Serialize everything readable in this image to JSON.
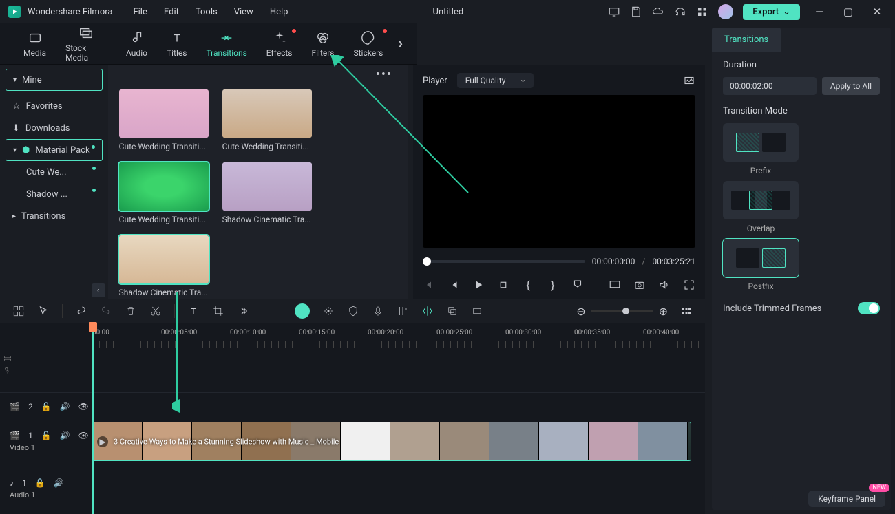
{
  "app": {
    "name": "Wondershare Filmora",
    "doc_title": "Untitled"
  },
  "menus": [
    "File",
    "Edit",
    "Tools",
    "View",
    "Help"
  ],
  "export_label": "Export",
  "toolbar": [
    {
      "id": "media",
      "label": "Media"
    },
    {
      "id": "stock-media",
      "label": "Stock Media"
    },
    {
      "id": "audio",
      "label": "Audio"
    },
    {
      "id": "titles",
      "label": "Titles"
    },
    {
      "id": "transitions",
      "label": "Transitions",
      "active": true
    },
    {
      "id": "effects",
      "label": "Effects",
      "dot": true
    },
    {
      "id": "filters",
      "label": "Filters"
    },
    {
      "id": "stickers",
      "label": "Stickers",
      "dot": true
    }
  ],
  "sidebar": {
    "mine": "Mine",
    "favorites": "Favorites",
    "downloads": "Downloads",
    "material_pack": "Material Pack",
    "sub1": "Cute We...",
    "sub2": "Shadow ...",
    "transitions": "Transitions"
  },
  "gallery": [
    {
      "label": "Cute Wedding Transiti...",
      "thumb": "#d9a5c8"
    },
    {
      "label": "Cute Wedding Transiti...",
      "thumb": "#c9a986"
    },
    {
      "label": "Cute Wedding Transiti...",
      "thumb": "#3bd46b",
      "sel": true
    },
    {
      "label": "Shadow Cinematic Tra...",
      "thumb": "#b8a0c4"
    },
    {
      "label": "Shadow Cinematic Tra...",
      "thumb": "#d6b896",
      "sel": true
    }
  ],
  "preview": {
    "player_label": "Player",
    "quality": "Full Quality",
    "current": "00:00:00:00",
    "total": "00:03:25:21"
  },
  "rpanel": {
    "tab": "Transitions",
    "duration_label": "Duration",
    "duration_value": "00:00:02:00",
    "apply_all": "Apply to All",
    "mode_label": "Transition Mode",
    "modes": [
      "Prefix",
      "Overlap",
      "Postfix"
    ],
    "include_trimmed": "Include Trimmed Frames",
    "keyframe_panel": "Keyframe Panel",
    "new_badge": "NEW"
  },
  "timeline": {
    "marks": [
      "00:00",
      "00:00:05:00",
      "00:00:10:00",
      "00:00:15:00",
      "00:00:20:00",
      "00:00:25:00",
      "00:00:30:00",
      "00:00:35:00",
      "00:00:40:00"
    ],
    "track_v_blank_count": "2",
    "track_v_label": "Video 1",
    "track_v_count": "1",
    "track_a_label": "Audio 1",
    "track_a_count": "1",
    "clip_title": "3 Creative Ways to Make a Stunning Slideshow with Music _ Mobile"
  }
}
